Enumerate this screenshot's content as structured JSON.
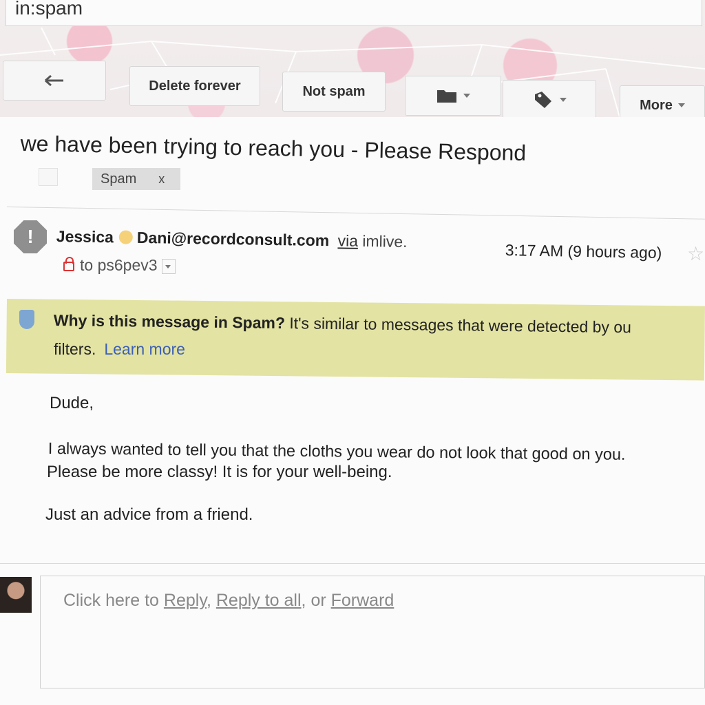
{
  "search": {
    "query": "in:spam"
  },
  "toolbar": {
    "back_icon": "reply-arrow-icon",
    "delete_forever": "Delete forever",
    "not_spam": "Not spam",
    "folder_icon": "folder-icon",
    "label_icon": "tag-icon",
    "more": "More"
  },
  "email": {
    "subject": "we have been trying to reach you - Please Respond",
    "label_chip": "Spam",
    "label_remove": "x",
    "sender_name": "Jessica",
    "sender_email": "Dani@recordconsult.com",
    "via": "via",
    "via_host": "imlive.",
    "time": "3:17 AM (9 hours ago)",
    "to": "to ps6pev3",
    "spam_notice_title": "Why is this message in Spam?",
    "spam_notice_text": "It's similar to messages that were detected by ou",
    "spam_notice_line2": "filters.",
    "learn_more": "Learn more",
    "body": {
      "greeting": "Dude,",
      "line1": "I always wanted to tell you that the cloths you wear do not look that good on you.",
      "line2": "Please be more classy! It is for your well-being.",
      "line3": "Just an advice from a friend."
    }
  },
  "reply": {
    "prefix": "Click here to",
    "reply": "Reply",
    "comma1": ",",
    "reply_all": "Reply to all",
    "or": ", or",
    "forward": "Forward"
  },
  "colors": {
    "spam_banner": "#e3e3a3",
    "link": "#3b5fb3",
    "warning_icon": "#8f8f8f"
  }
}
